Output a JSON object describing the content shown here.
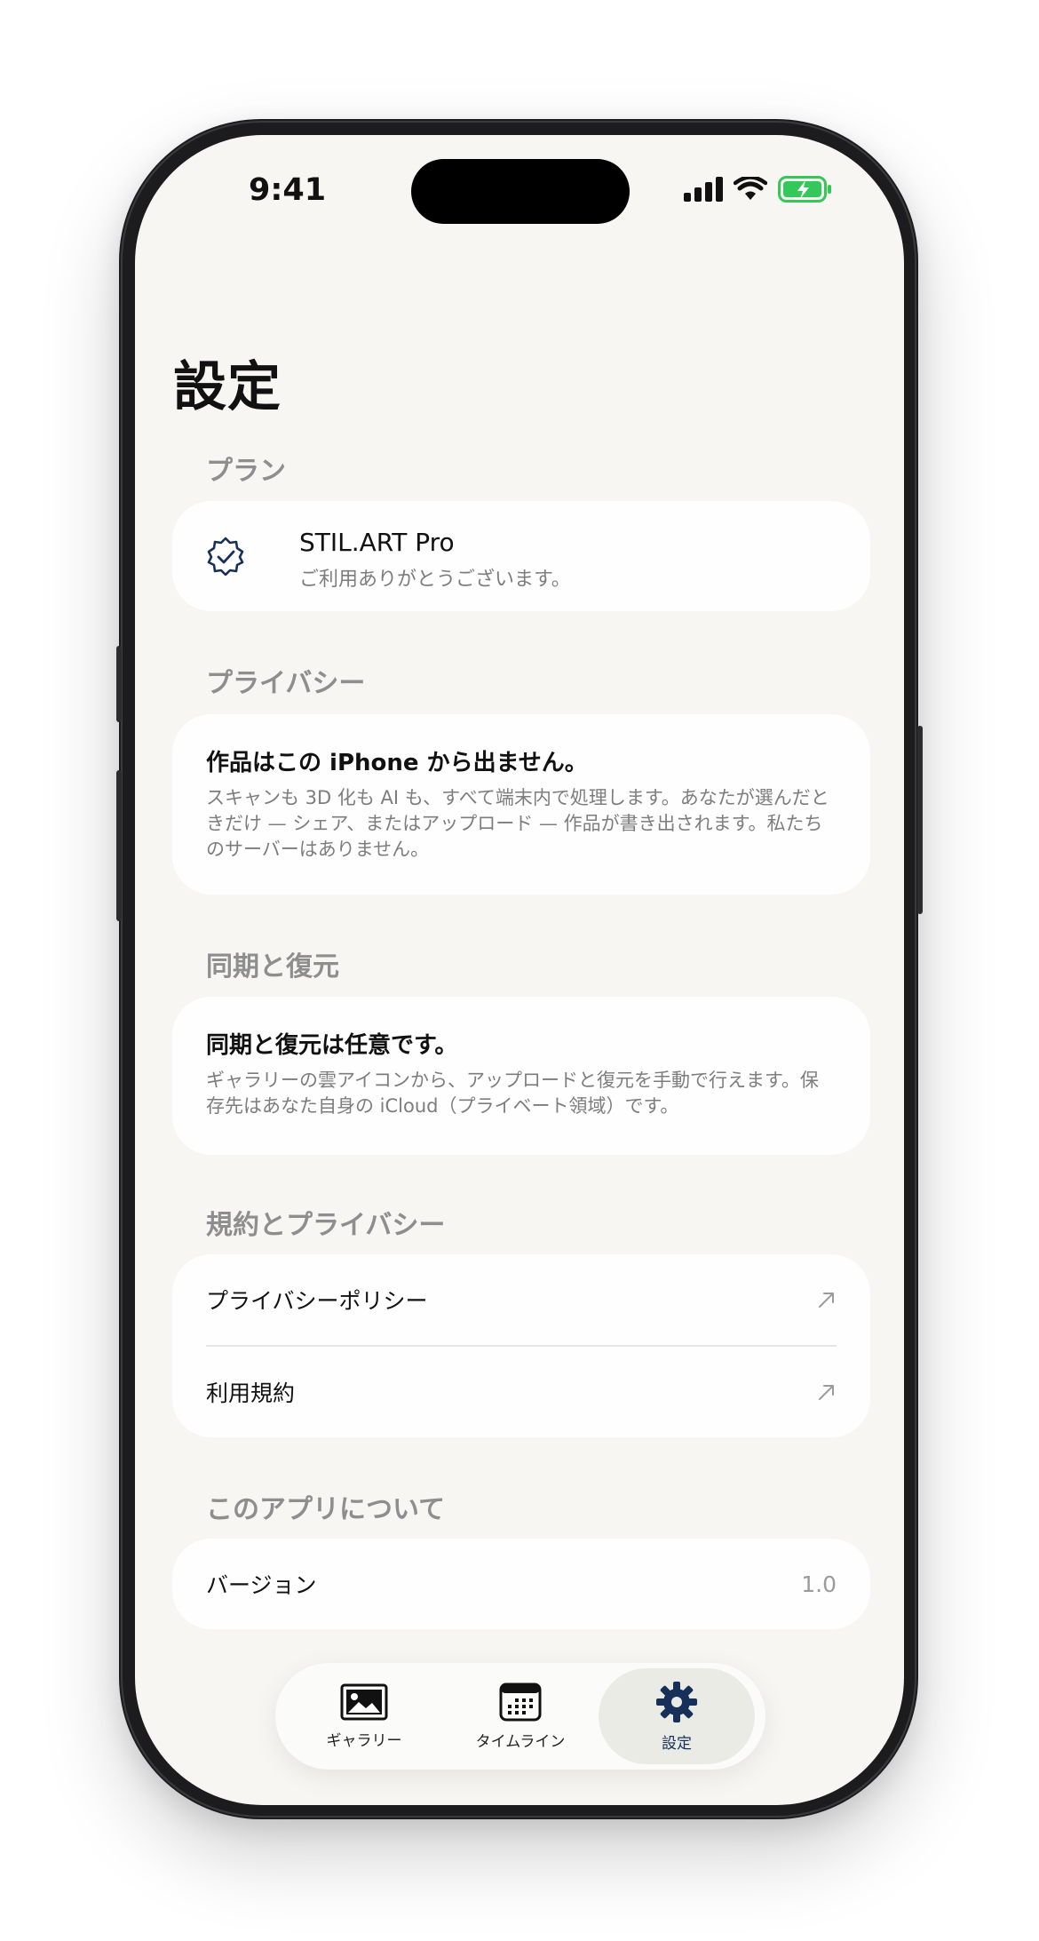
{
  "status_bar": {
    "time": "9:41"
  },
  "page": {
    "title": "設定"
  },
  "sections": {
    "plan": {
      "header": "プラン",
      "title": "STIL.ART Pro",
      "subtitle": "ご利用ありがとうございます。"
    },
    "privacy": {
      "header": "プライバシー",
      "title": "作品はこの iPhone から出ません。",
      "body": "スキャンも 3D 化も AI も、すべて端末内で処理します。あなたが選んだときだけ — シェア、またはアップロード — 作品が書き出されます。私たちのサーバーはありません。"
    },
    "sync": {
      "header": "同期と復元",
      "title": "同期と復元は任意です。",
      "body": "ギャラリーの雲アイコンから、アップロードと復元を手動で行えます。保存先はあなた自身の iCloud（プライベート領域）です。"
    },
    "legal": {
      "header": "規約とプライバシー",
      "items": [
        {
          "label": "プライバシーポリシー"
        },
        {
          "label": "利用規約"
        }
      ]
    },
    "about": {
      "header": "このアプリについて",
      "version_label": "バージョン",
      "version_value": "1.0"
    }
  },
  "tabs": [
    {
      "label": "ギャラリー",
      "icon": "photo-icon",
      "active": false
    },
    {
      "label": "タイムライン",
      "icon": "calendar-icon",
      "active": false
    },
    {
      "label": "設定",
      "icon": "gear-icon",
      "active": true
    }
  ],
  "colors": {
    "accent": "#17305a",
    "background": "#f7f6f2",
    "battery": "#34c759"
  }
}
